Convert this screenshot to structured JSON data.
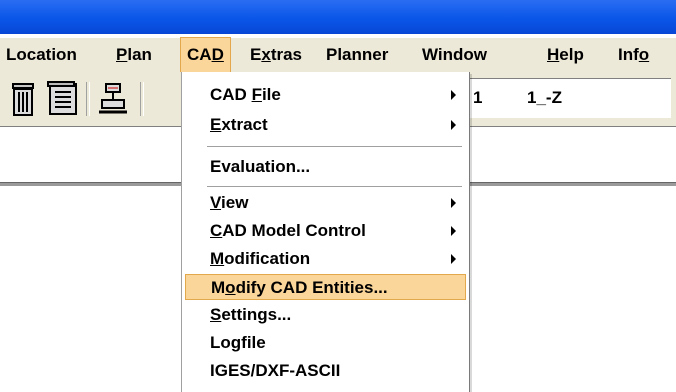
{
  "menubar": {
    "items": [
      {
        "label": "Location"
      },
      {
        "label_pre": "",
        "accel": "P",
        "label_post": "lan"
      },
      {
        "label_pre": "CA",
        "accel": "D",
        "label_post": ""
      },
      {
        "label_pre": "E",
        "accel": "x",
        "label_post": "tras"
      },
      {
        "label": "Planner"
      },
      {
        "label": "Window"
      },
      {
        "label_pre": "",
        "accel": "H",
        "label_post": "elp"
      },
      {
        "label_pre": "Inf",
        "accel": "o",
        "label_post": ""
      }
    ]
  },
  "toolbar": {
    "field_text_1": "1",
    "field_text_2": "1_-Z",
    "icons": [
      "trash-icon",
      "document-list-icon",
      "cad-stamp-icon"
    ]
  },
  "cad_menu": {
    "items": [
      {
        "pre": "CAD ",
        "accel": "F",
        "post": "ile",
        "submenu": true
      },
      {
        "pre": "",
        "accel": "E",
        "post": "xtract",
        "submenu": true
      },
      {
        "pre": "Evaluation...",
        "accel": "",
        "post": "",
        "submenu": false
      },
      {
        "pre": "",
        "accel": "V",
        "post": "iew",
        "submenu": true
      },
      {
        "pre": "",
        "accel": "C",
        "post": "AD Model Control",
        "submenu": true
      },
      {
        "pre": "",
        "accel": "M",
        "post": "odification",
        "submenu": true
      },
      {
        "pre": "M",
        "accel": "o",
        "post": "dify CAD Entities...",
        "submenu": false
      },
      {
        "pre": "",
        "accel": "S",
        "post": "ettings...",
        "submenu": false
      },
      {
        "pre": "Logfile",
        "accel": "",
        "post": "",
        "submenu": false
      },
      {
        "pre": "IGES/DXF-ASCII",
        "accel": "",
        "post": "",
        "submenu": false
      }
    ],
    "highlighted_index": 6
  },
  "colors": {
    "title_bar": "#0a56e8",
    "menu_face": "#ece9d8",
    "highlight": "#fbd69a",
    "highlight_border": "#e2a84b"
  }
}
